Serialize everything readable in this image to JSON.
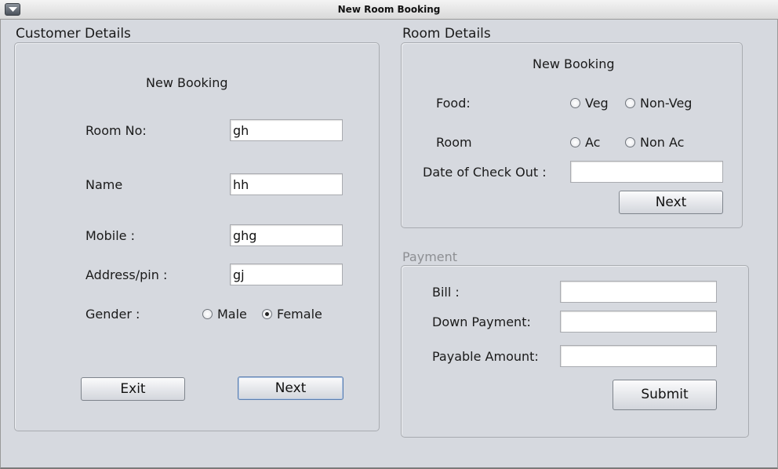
{
  "window": {
    "title": "New Room Booking",
    "menu_icon": "dropdown-arrow-icon"
  },
  "customer": {
    "section_title": "Customer Details",
    "heading": "New Booking",
    "room_no_label": "Room No:",
    "room_no_value": "gh",
    "name_label": "Name",
    "name_value": "hh",
    "mobile_label": "Mobile :",
    "mobile_value": "ghg",
    "address_label": "Address/pin :",
    "address_value": "gj",
    "gender_label": "Gender :",
    "gender_options": [
      {
        "label": "Male",
        "checked": false
      },
      {
        "label": "Female",
        "checked": true
      }
    ],
    "exit_label": "Exit",
    "next_label": "Next"
  },
  "room": {
    "section_title": "Room Details",
    "heading": "New Booking",
    "food_label": "Food:",
    "food_options": [
      {
        "label": "Veg",
        "checked": false
      },
      {
        "label": "Non-Veg",
        "checked": false
      }
    ],
    "room_label": "Room",
    "room_options": [
      {
        "label": "Ac",
        "checked": false
      },
      {
        "label": "Non Ac",
        "checked": false
      }
    ],
    "checkout_label": "Date of Check Out :",
    "checkout_value": "",
    "next_label": "Next"
  },
  "payment": {
    "section_title": "Payment",
    "bill_label": "Bill :",
    "bill_value": "",
    "down_payment_label": "Down Payment:",
    "down_payment_value": "",
    "payable_label": "Payable Amount:",
    "payable_value": "",
    "submit_label": "Submit"
  }
}
